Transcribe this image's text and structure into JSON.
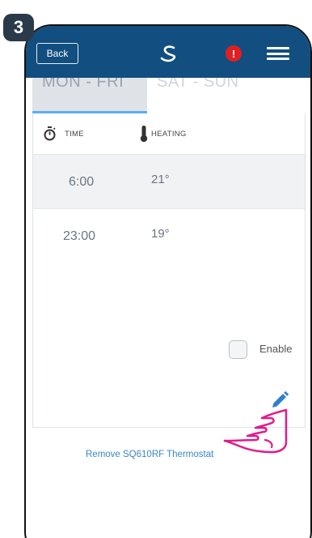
{
  "step": {
    "number": "3"
  },
  "header": {
    "back_label": "Back",
    "logo_icon": "salus-logo-icon",
    "alert_label": "!",
    "menu_icon": "hamburger-menu-icon",
    "colors": {
      "bar": "#124e7f",
      "alert": "#e02020"
    }
  },
  "tabs": [
    {
      "label": "MON - FRI",
      "selected": true
    },
    {
      "label": "SAT - SUN",
      "selected": false
    }
  ],
  "schedule": {
    "time_header": "TIME",
    "heating_header": "HEATING",
    "time_icon": "stopwatch-icon",
    "heating_icon": "thermometer-icon",
    "rows": [
      {
        "time": "6:00",
        "temp": "21°"
      },
      {
        "time": "23:00",
        "temp": "19°"
      }
    ]
  },
  "enable": {
    "label": "Enable",
    "checked": false
  },
  "edit_icon": "pencil-edit-icon",
  "remove_link": "Remove SQ610RF Thermostat",
  "pointer_icon": "pointing-hand-icon"
}
